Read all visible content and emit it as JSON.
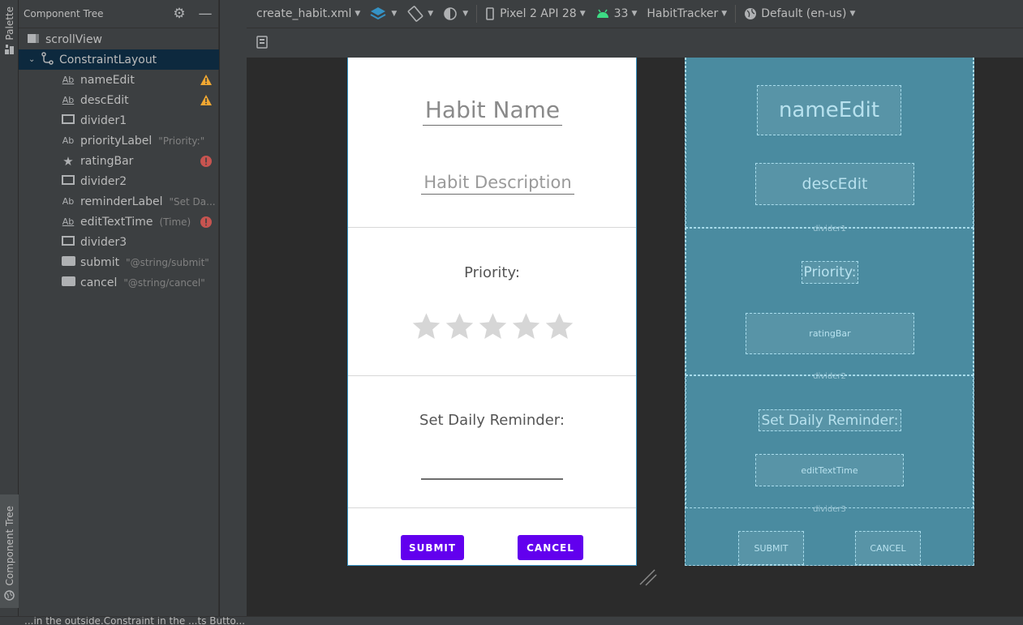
{
  "left_strip": {
    "palette_label": "Palette",
    "tree_label": "Component Tree"
  },
  "tree": {
    "title": "Component Tree",
    "items": [
      {
        "name": "scrollView",
        "hint": ""
      },
      {
        "name": "ConstraintLayout",
        "hint": ""
      },
      {
        "name": "nameEdit",
        "hint": ""
      },
      {
        "name": "descEdit",
        "hint": ""
      },
      {
        "name": "divider1",
        "hint": ""
      },
      {
        "name": "priorityLabel",
        "hint": "\"Priority:\""
      },
      {
        "name": "ratingBar",
        "hint": ""
      },
      {
        "name": "divider2",
        "hint": ""
      },
      {
        "name": "reminderLabel",
        "hint": "\"Set Da..."
      },
      {
        "name": "editTextTime",
        "hint": "(Time)"
      },
      {
        "name": "divider3",
        "hint": ""
      },
      {
        "name": "submit",
        "hint": "\"@string/submit\""
      },
      {
        "name": "cancel",
        "hint": "\"@string/cancel\""
      }
    ]
  },
  "toolbar": {
    "file": "create_habit.xml",
    "device": "Pixel 2 API 28",
    "api": "33",
    "theme": "HabitTracker",
    "locale": "Default (en-us)"
  },
  "design": {
    "name_hint": "Habit Name",
    "desc_hint": "Habit Description",
    "priority_label": "Priority:",
    "reminder_label": "Set Daily Reminder:",
    "rating": {
      "filled": 0,
      "max": 5
    },
    "submit": "SUBMIT",
    "cancel": "CANCEL"
  },
  "blueprint": {
    "nameEdit": "nameEdit",
    "descEdit": "descEdit",
    "divider1": "divider1",
    "priority": "Priority:",
    "ratingBar": "ratingBar",
    "divider2": "divider2",
    "reminder": "Set Daily Reminder:",
    "editTextTime": "editTextTime",
    "divider3": "divider3",
    "submit": "SUBMIT",
    "cancel": "CANCEL"
  },
  "status": {
    "text": "...in the outside.Constraint in the ...ts Butto..."
  },
  "colors": {
    "accent_button": "#6200ee",
    "warning": "#f0a732",
    "error": "#c75450",
    "selection": "#0d293e",
    "blueprint_bg": "#4a8ba0"
  }
}
